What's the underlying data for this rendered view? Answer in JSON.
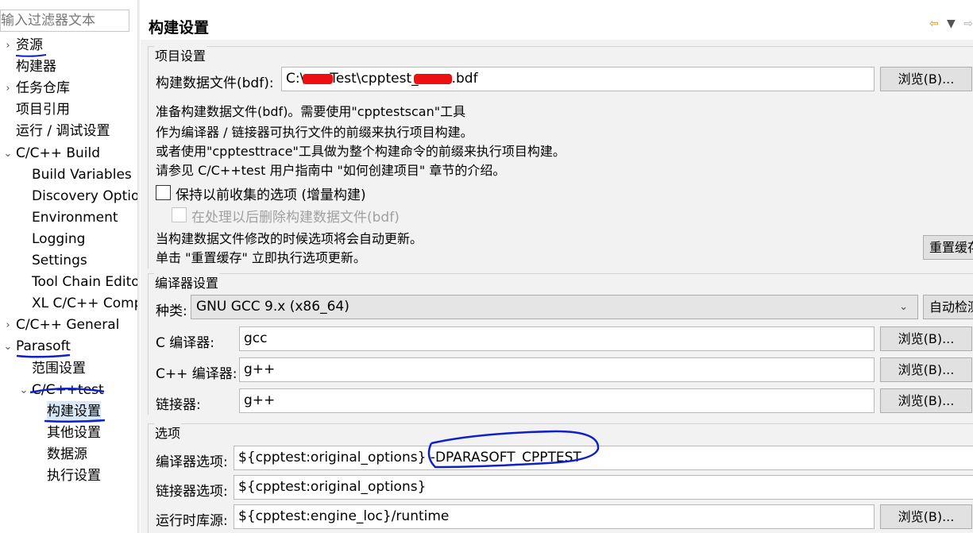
{
  "left": {
    "filter_placeholder": "输入过滤器文本",
    "tree": [
      {
        "id": "resource",
        "label": "资源",
        "arrow": "›",
        "indent": 0,
        "underline": true
      },
      {
        "id": "builders",
        "label": "构建器",
        "arrow": "",
        "indent": 0
      },
      {
        "id": "task-repo",
        "label": "任务仓库",
        "arrow": "›",
        "indent": 0
      },
      {
        "id": "project-refs",
        "label": "项目引用",
        "arrow": "",
        "indent": 0
      },
      {
        "id": "run-debug",
        "label": "运行 / 调试设置",
        "arrow": "",
        "indent": 0
      },
      {
        "id": "cpp-build",
        "label": "C/C++ Build",
        "arrow": "⌄",
        "indent": 0
      },
      {
        "id": "build-variables",
        "label": "Build Variables",
        "arrow": "",
        "indent": 1
      },
      {
        "id": "discovery-options",
        "label": "Discovery Options",
        "arrow": "",
        "indent": 1
      },
      {
        "id": "environment",
        "label": "Environment",
        "arrow": "",
        "indent": 1
      },
      {
        "id": "logging",
        "label": "Logging",
        "arrow": "",
        "indent": 1
      },
      {
        "id": "settings",
        "label": "Settings",
        "arrow": "",
        "indent": 1
      },
      {
        "id": "tool-chain-editor",
        "label": "Tool Chain Editor",
        "arrow": "",
        "indent": 1
      },
      {
        "id": "xl-cpp-compiler",
        "label": "XL C/C++ Compiler",
        "arrow": "",
        "indent": 1
      },
      {
        "id": "cpp-general",
        "label": "C/C++ General",
        "arrow": "›",
        "indent": 0
      },
      {
        "id": "parasoft",
        "label": "Parasoft",
        "arrow": "⌄",
        "indent": 0
      },
      {
        "id": "scope-settings",
        "label": "范围设置",
        "arrow": "",
        "indent": 1
      },
      {
        "id": "cpptest",
        "label": "C/C++test",
        "arrow": "⌄",
        "indent": 1
      },
      {
        "id": "build-settings",
        "label": "构建设置",
        "arrow": "",
        "indent": 2,
        "selected": true
      },
      {
        "id": "other-settings",
        "label": "其他设置",
        "arrow": "",
        "indent": 2
      },
      {
        "id": "data-sources",
        "label": "数据源",
        "arrow": "",
        "indent": 2
      },
      {
        "id": "exec-settings",
        "label": "执行设置",
        "arrow": "",
        "indent": 2
      }
    ]
  },
  "header": {
    "title": "构建设置",
    "back_icon": "⇦",
    "menu_icon": "▼",
    "forward_icon": "⇨"
  },
  "project": {
    "group_title": "项目设置",
    "bdf_label": "构建数据文件(bdf):",
    "bdf_value_part1": "C:\\",
    "bdf_value_part2": "Test\\cpptest_",
    "bdf_value_part3": ".bdf",
    "browse_label": "浏览(B)...",
    "desc1": "准备构建数据文件(bdf)。需要使用\"cpptestscan\"工具",
    "desc2": "作为编译器 / 链接器可执行文件的前缀来执行项目构建。",
    "desc3": "或者使用\"cpptesttrace\"工具做为整个构建命令的前缀来执行项目构建。",
    "desc4": "请参见  C/C++test 用户指南中 \"如何创建项目\" 章节的介绍。",
    "keep_options_label": "保持以前收集的选项 (增量构建)",
    "delete_bdf_label": "在处理以后删除构建数据文件(bdf)",
    "auto_update1": "当构建数据文件修改的时候选项将会自动更新。",
    "auto_update2": "单击 \"重置缓存\" 立即执行选项更新。",
    "reset_cache_label": "重置缓存"
  },
  "compiler": {
    "group_title": "编译器设置",
    "kind_label": "种类:",
    "kind_value": "GNU GCC 9.x (x86_64)",
    "auto_detect_label": "自动检测",
    "c_compiler_label": "C 编译器:",
    "c_compiler_value": "gcc",
    "cpp_compiler_label": "C++ 编译器:",
    "cpp_compiler_value": "g++",
    "linker_label": "链接器:",
    "linker_value": "g++",
    "browse_label": "浏览(B)..."
  },
  "options": {
    "group_title": "选项",
    "compiler_opts_label": "编译器选项:",
    "compiler_opts_value": "${cpptest:original_options} -DPARASOFT_CPPTEST",
    "linker_opts_label": "链接器选项:",
    "linker_opts_value": "${cpptest:original_options}",
    "runtime_label": "运行时库源:",
    "runtime_value": "${cpptest:engine_loc}/runtime",
    "browse_label": "浏览(B)..."
  },
  "colors": {
    "annotation": "#1020c8",
    "redaction": "#ee1010",
    "selection": "#d9e8f7"
  }
}
